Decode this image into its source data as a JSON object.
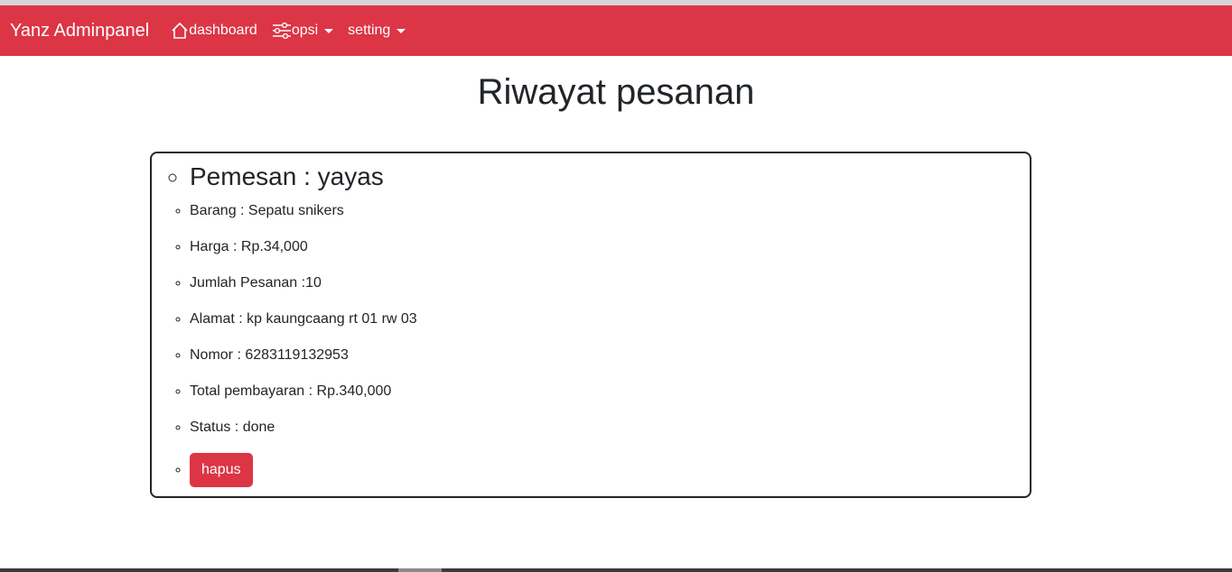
{
  "navbar": {
    "brand": "Yanz Adminpanel",
    "dashboard_label": "dashboard",
    "opsi_label": "opsi",
    "setting_label": "setting",
    "color": "#dc3545"
  },
  "page": {
    "title": "Riwayat pesanan"
  },
  "order": {
    "pemesan": "Pemesan : yayas",
    "barang": "Barang : Sepatu snikers",
    "harga": "Harga : Rp.34,000",
    "jumlah": "Jumlah Pesanan :10",
    "alamat": "Alamat : kp kaungcaang rt 01 rw 03",
    "nomor": "Nomor : 6283119132953",
    "total": "Total pembayaran : Rp.340,000",
    "status": "Status : done",
    "delete_label": "hapus"
  },
  "icons": {
    "dashboard": "house-icon",
    "opsi": "sliders-icon",
    "dropdown": "caret-down-icon"
  }
}
